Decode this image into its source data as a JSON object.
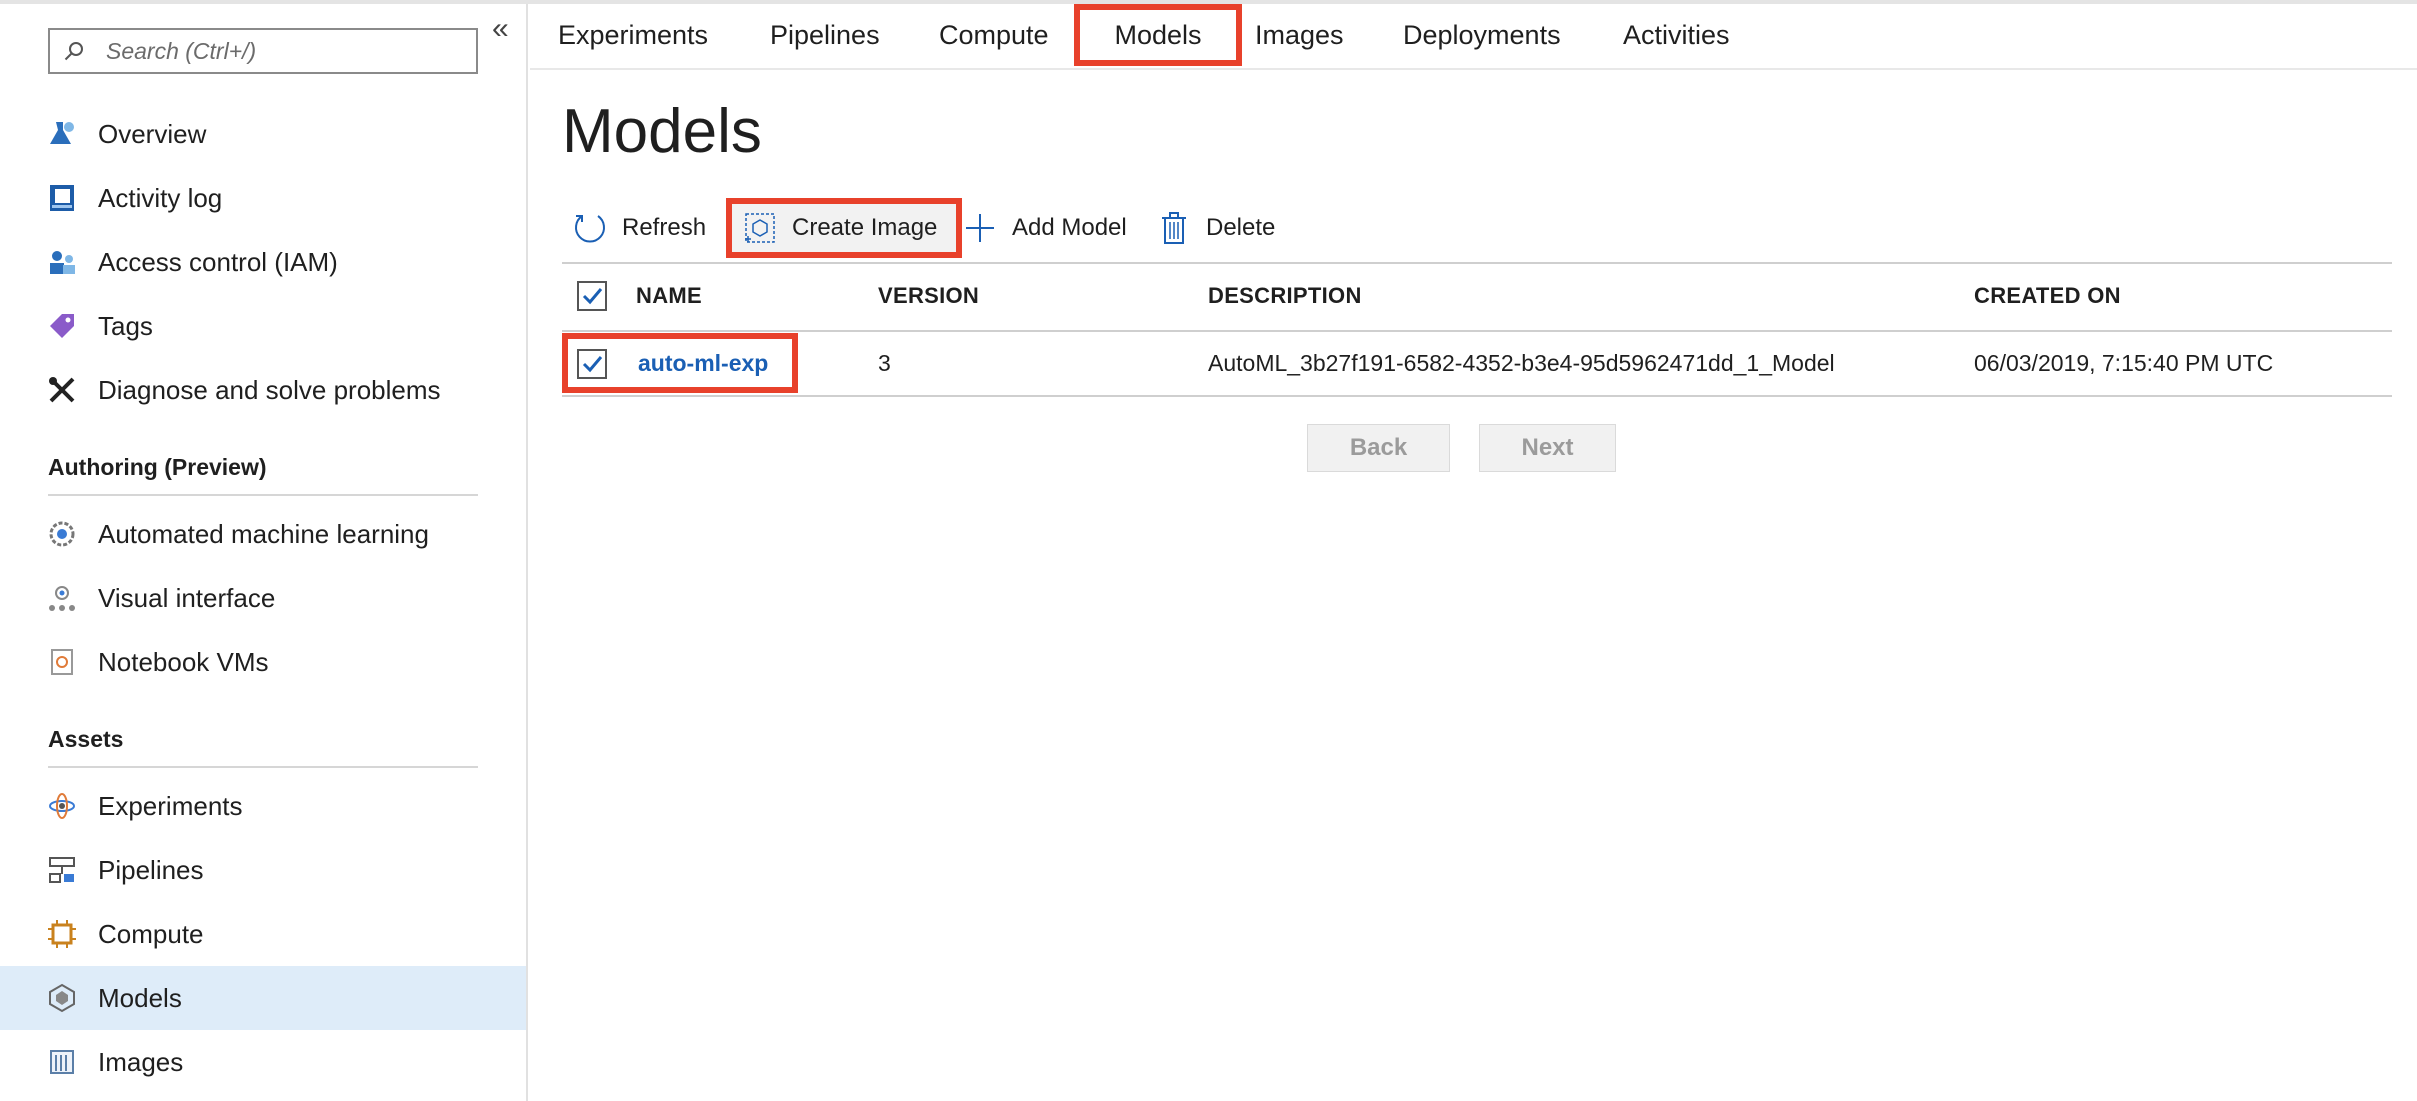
{
  "search": {
    "placeholder": "Search (Ctrl+/)"
  },
  "sidebar": {
    "collapse_glyph": "«",
    "items": [
      {
        "label": "Overview",
        "icon": "overview-icon"
      },
      {
        "label": "Activity log",
        "icon": "activity-log-icon"
      },
      {
        "label": "Access control (IAM)",
        "icon": "access-control-icon"
      },
      {
        "label": "Tags",
        "icon": "tag-icon"
      },
      {
        "label": "Diagnose and solve problems",
        "icon": "wrench-icon"
      }
    ],
    "authoring": {
      "heading": "Authoring (Preview)",
      "items": [
        {
          "label": "Automated machine learning",
          "icon": "automl-icon"
        },
        {
          "label": "Visual interface",
          "icon": "visual-interface-icon"
        },
        {
          "label": "Notebook VMs",
          "icon": "notebook-icon"
        }
      ]
    },
    "assets": {
      "heading": "Assets",
      "items": [
        {
          "label": "Experiments",
          "icon": "experiments-icon"
        },
        {
          "label": "Pipelines",
          "icon": "pipelines-icon"
        },
        {
          "label": "Compute",
          "icon": "compute-icon"
        },
        {
          "label": "Models",
          "icon": "models-icon",
          "active": true
        },
        {
          "label": "Images",
          "icon": "images-icon"
        }
      ]
    }
  },
  "tabs": [
    "Experiments",
    "Pipelines",
    "Compute",
    "Models",
    "Images",
    "Deployments",
    "Activities"
  ],
  "selected_tab": "Models",
  "page": {
    "title": "Models"
  },
  "toolbar": {
    "refresh": "Refresh",
    "create_image": "Create Image",
    "add_model": "Add Model",
    "delete": "Delete"
  },
  "table": {
    "columns": [
      "NAME",
      "VERSION",
      "DESCRIPTION",
      "CREATED ON"
    ],
    "rows": [
      {
        "name": "auto-ml-exp",
        "version": "3",
        "description": "AutoML_3b27f191-6582-4352-b3e4-95d5962471dd_1_Model",
        "created_on": "06/03/2019, 7:15:40 PM UTC",
        "checked": true
      }
    ],
    "header_checked": true
  },
  "pagination": {
    "back": "Back",
    "next": "Next"
  },
  "colors": {
    "highlight": "#e8412b",
    "link": "#1a5fb4",
    "active_nav": "#deecf9",
    "checkbox": "#1a5fb4"
  }
}
